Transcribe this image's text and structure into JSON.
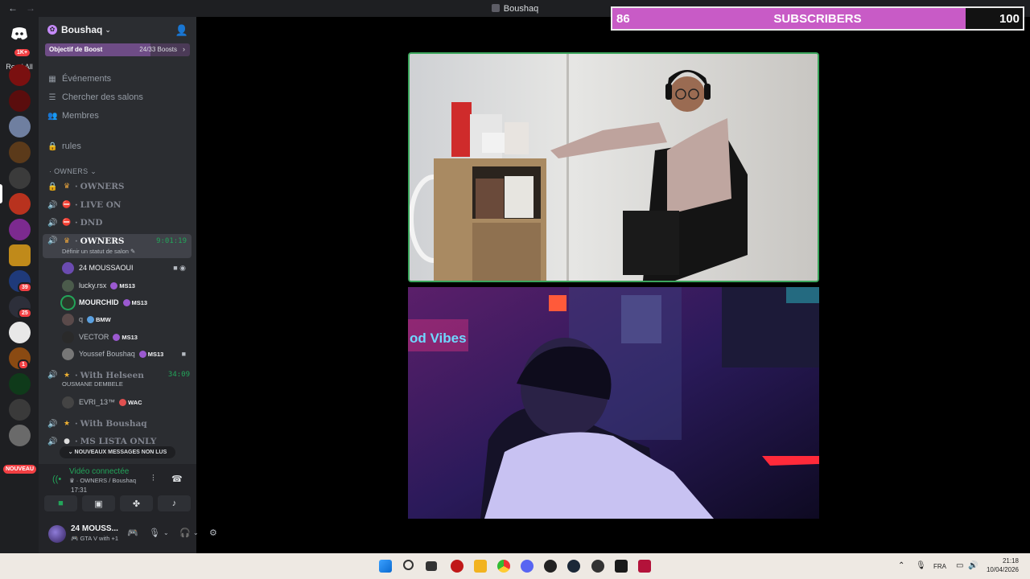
{
  "window": {
    "title": "Boushaq"
  },
  "servers": {
    "mentions_badge": "1K+",
    "read_all": "Read All",
    "badges": {
      "s10": "39",
      "s11": "25",
      "s14": "1"
    },
    "nouveau": "NOUVEAU"
  },
  "server": {
    "name": "Boushaq"
  },
  "boost": {
    "label": "Objectif de Boost",
    "count": "24/33 Boosts",
    "progress": 0.727
  },
  "nav": {
    "events": "Événements",
    "browse": "Chercher des salons",
    "members": "Membres",
    "rules": "rules"
  },
  "category": {
    "name": "OWNERS"
  },
  "channels": [
    {
      "name": "OWNERS"
    },
    {
      "name": "LIVE ON"
    },
    {
      "name": "DND"
    }
  ],
  "active_channel": {
    "name": "OWNERS",
    "timer": "9:01:19",
    "status": "Définir un statut de salon"
  },
  "voice_users": [
    {
      "name": "24 MOUSSAOUI",
      "tag": ""
    },
    {
      "name": "lucky.rsx",
      "tag": "MS13"
    },
    {
      "name": "MOURCHID",
      "tag": "MS13"
    },
    {
      "name": "q",
      "tag": "BMW"
    },
    {
      "name": "VECTOR",
      "tag": "MS13"
    },
    {
      "name": "Youssef Boushaq",
      "tag": "MS13"
    }
  ],
  "channel_helseen": {
    "name": "With Helseen",
    "timer": "34:09",
    "status": "OUSMANE DEMBELE"
  },
  "helseen_user": {
    "name": "EVRI_13™",
    "tag": "WAC"
  },
  "channel_boushaq": {
    "name": "With Boushaq"
  },
  "channel_ms": {
    "name": "MS LISTA ONLY"
  },
  "new_messages": "NOUVEAUX MESSAGES NON LUS",
  "voice_panel": {
    "status": "Vidéo connectée",
    "channel": "OWNERS / Boushaq",
    "time": "17:31"
  },
  "user_panel": {
    "name": "24 MOUSS...",
    "activity": "GTA V with +1"
  },
  "subscribers": {
    "current": "86",
    "label": "SUBSCRIBERS",
    "goal": "100",
    "progress": 0.86
  },
  "taskbar": {
    "lang": "FRA",
    "time": "21:18",
    "date": "10/04/2026"
  },
  "colors": {
    "accent_green": "#23a55a",
    "boost_purple": "#6e4c86",
    "subs_pink": "#c85bc6"
  }
}
